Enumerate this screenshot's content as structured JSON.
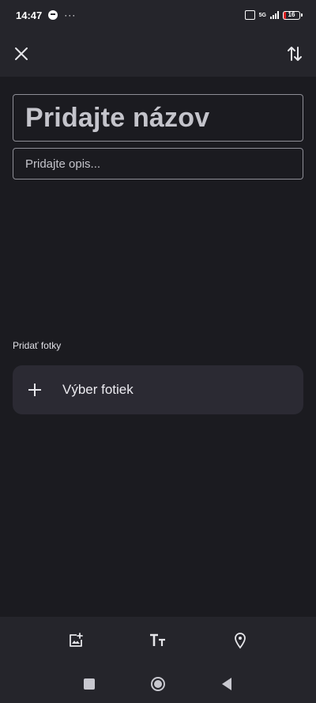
{
  "status_bar": {
    "time": "14:47",
    "more": "···",
    "volte": "VoLTE",
    "network": "5G",
    "battery": "16"
  },
  "app_bar": {
    "close_icon": "close-icon",
    "sort_icon": "swap-vertical-icon"
  },
  "form": {
    "title_placeholder": "Pridajte názov",
    "description_placeholder": "Pridajte opis..."
  },
  "photos": {
    "section_label": "Pridať fotky",
    "pick_label": "Výber fotiek"
  },
  "toolbar": {
    "icons": [
      "add-photo-icon",
      "text-format-icon",
      "location-pin-icon"
    ]
  },
  "nav": {
    "icons": [
      "recents-icon",
      "home-icon",
      "back-icon"
    ]
  },
  "colors": {
    "background": "#1b1b20",
    "surface": "#25252b",
    "card": "#2b2a33",
    "outline": "#8e8e96",
    "text": "#e6e6ea"
  }
}
